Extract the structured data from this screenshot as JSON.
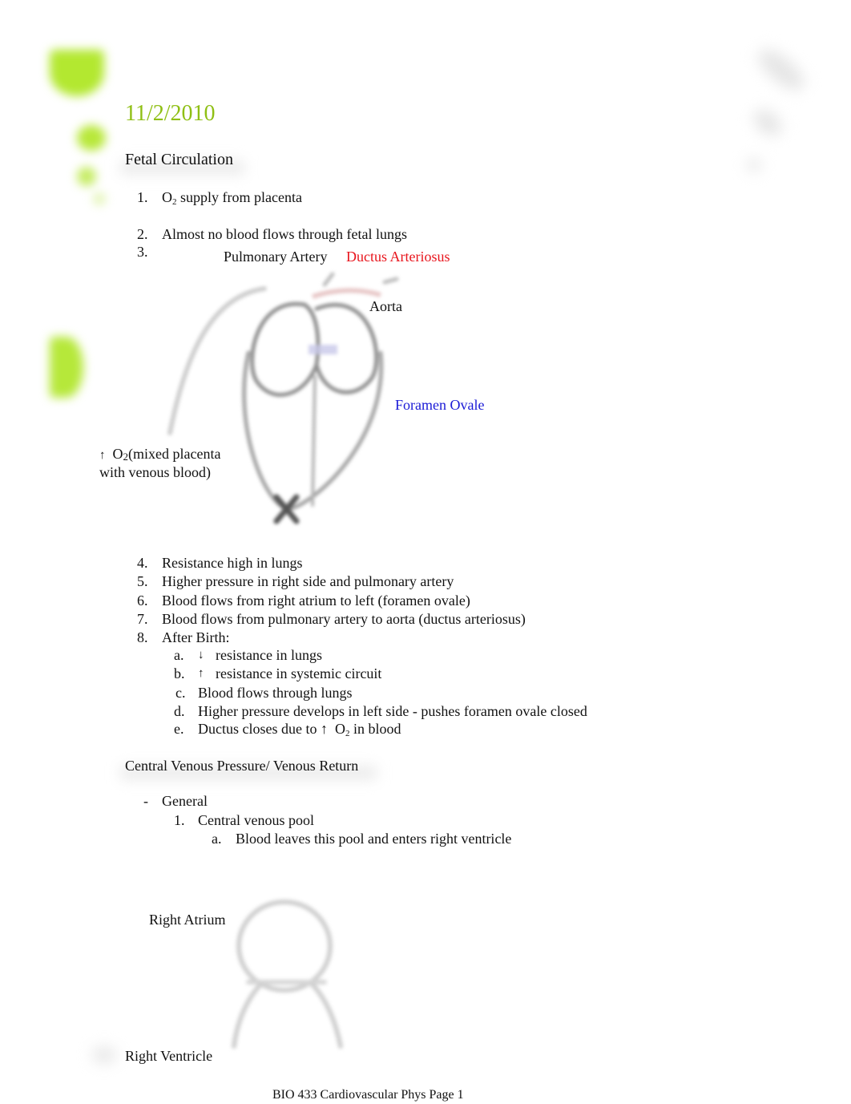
{
  "page": {
    "date": "11/2/2010",
    "footer": "BIO 433 Cardiovascular Phys Page 1",
    "accent_color": "#8fbf14"
  },
  "fetal": {
    "heading": "Fetal Circulation",
    "items_top": [
      {
        "num": "1.",
        "pre": "O",
        "sub": "2",
        "post": " supply from placenta"
      },
      {
        "num": "2.",
        "text": "Almost no blood flows through fetal lungs"
      },
      {
        "num": "3.",
        "text": ""
      }
    ],
    "diagram_labels": {
      "pulmonary_artery": "Pulmonary Artery",
      "ductus_arteriosus": "Ductus Arteriosus",
      "aorta": "Aorta",
      "foramen_ovale": "Foramen Ovale",
      "o2_line1_arrow": "↑",
      "o2_line1_pre": "O",
      "o2_line1_sub": "2",
      "o2_line1_post": "(mixed placenta",
      "o2_line2": "with venous blood)"
    },
    "items_bottom": [
      {
        "num": "4.",
        "text": "Resistance high in lungs"
      },
      {
        "num": "5.",
        "text": "Higher pressure in right side and pulmonary artery"
      },
      {
        "num": "6.",
        "text": "Blood flows from right atrium to left (foramen ovale)"
      },
      {
        "num": "7.",
        "text": "Blood flows from pulmonary artery to aorta (ductus arteriosus)"
      },
      {
        "num": "8.",
        "text": "After Birth:"
      }
    ],
    "after_birth": [
      {
        "letter": "a.",
        "arrow": "↓",
        "text": "resistance in lungs"
      },
      {
        "letter": "b.",
        "arrow": "↑",
        "text": "resistance in systemic circuit"
      },
      {
        "letter": "c.",
        "text": "Blood flows through lungs"
      },
      {
        "letter": "d.",
        "text": "Higher pressure develops in left side - pushes foramen ovale closed"
      },
      {
        "letter": "e.",
        "pre": "Ductus closes due to ↑  O",
        "sub": "2",
        "post": " in blood"
      }
    ]
  },
  "cvp": {
    "heading": "Central Venous Pressure/ Venous Return",
    "bullet": "-",
    "general": "General",
    "item1_num": "1.",
    "item1": "Central venous pool",
    "item1a_letter": "a.",
    "item1a": "Blood leaves this pool and enters right ventricle",
    "labels": {
      "right_atrium": "Right Atrium",
      "right_ventricle": "Right Ventricle"
    }
  }
}
